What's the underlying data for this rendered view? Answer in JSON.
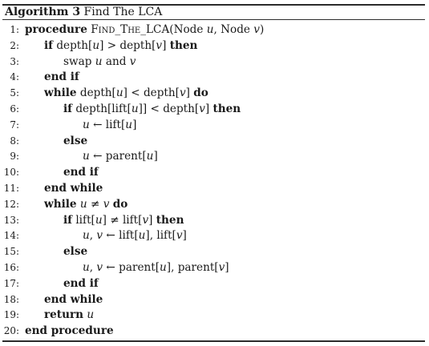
{
  "algorithm": {
    "label": "Algorithm 3",
    "title": "Find The LCA"
  },
  "lines": [
    {
      "num": "1:",
      "indent": 0,
      "kw": "procedure",
      "text": "",
      "sc": "Find_The_LCA",
      "rest": "(Node u, Node v)"
    },
    {
      "num": "2:",
      "indent": 1,
      "kw": "if",
      "text": " depth[u] > depth[v] ",
      "kw2": "then"
    },
    {
      "num": "3:",
      "indent": 2,
      "kw": "",
      "text": "swap u and v"
    },
    {
      "num": "4:",
      "indent": 1,
      "kw": "end if",
      "text": ""
    },
    {
      "num": "5:",
      "indent": 1,
      "kw": "while",
      "text": " depth[u] < depth[v] ",
      "kw2": "do"
    },
    {
      "num": "6:",
      "indent": 2,
      "kw": "if",
      "text": " depth[lift[u]] < depth[v] ",
      "kw2": "then"
    },
    {
      "num": "7:",
      "indent": 3,
      "kw": "",
      "text": "u ← lift[u]"
    },
    {
      "num": "8:",
      "indent": 2,
      "kw": "else",
      "text": ""
    },
    {
      "num": "9:",
      "indent": 3,
      "kw": "",
      "text": "u ← parent[u]"
    },
    {
      "num": "10:",
      "indent": 2,
      "kw": "end if",
      "text": ""
    },
    {
      "num": "11:",
      "indent": 1,
      "kw": "end while",
      "text": ""
    },
    {
      "num": "12:",
      "indent": 1,
      "kw": "while",
      "text": " u ≠ v ",
      "kw2": "do"
    },
    {
      "num": "13:",
      "indent": 2,
      "kw": "if",
      "text": " lift[u] ≠ lift[v] ",
      "kw2": "then"
    },
    {
      "num": "14:",
      "indent": 3,
      "kw": "",
      "text": "u, v ← lift[u], lift[v]"
    },
    {
      "num": "15:",
      "indent": 2,
      "kw": "else",
      "text": ""
    },
    {
      "num": "16:",
      "indent": 3,
      "kw": "",
      "text": "u, v ← parent[u], parent[v]"
    },
    {
      "num": "17:",
      "indent": 2,
      "kw": "end if",
      "text": ""
    },
    {
      "num": "18:",
      "indent": 1,
      "kw": "end while",
      "text": ""
    },
    {
      "num": "19:",
      "indent": 1,
      "kw": "return",
      "text": " u"
    },
    {
      "num": "20:",
      "indent": 0,
      "kw": "end procedure",
      "text": ""
    }
  ]
}
